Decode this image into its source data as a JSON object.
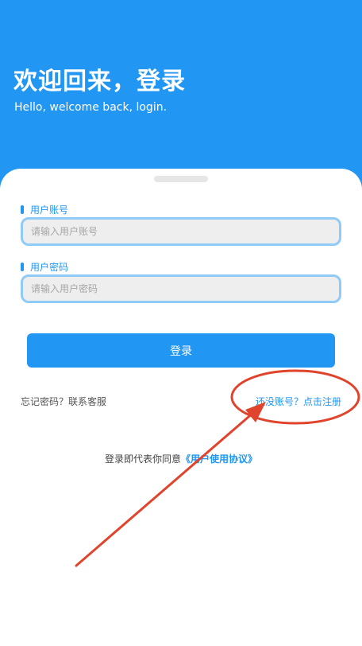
{
  "header": {
    "title": "欢迎回来，登录",
    "subtitle": "Hello, welcome back, login."
  },
  "form": {
    "username": {
      "label": "用户账号",
      "placeholder": "请输入用户账号",
      "value": ""
    },
    "password": {
      "label": "用户密码",
      "placeholder": "请输入用户密码",
      "value": ""
    },
    "submit_label": "登录"
  },
  "links": {
    "forgot": "忘记密码？联系客服",
    "register": "还没账号？点击注册"
  },
  "agreement": {
    "prefix": "登录即代表你同意",
    "link": "《用户使用协议》"
  },
  "colors": {
    "primary": "#2196f3",
    "input_border": "#90cbf5",
    "input_bg": "#eeeeee",
    "annotation": "#e0442c"
  }
}
